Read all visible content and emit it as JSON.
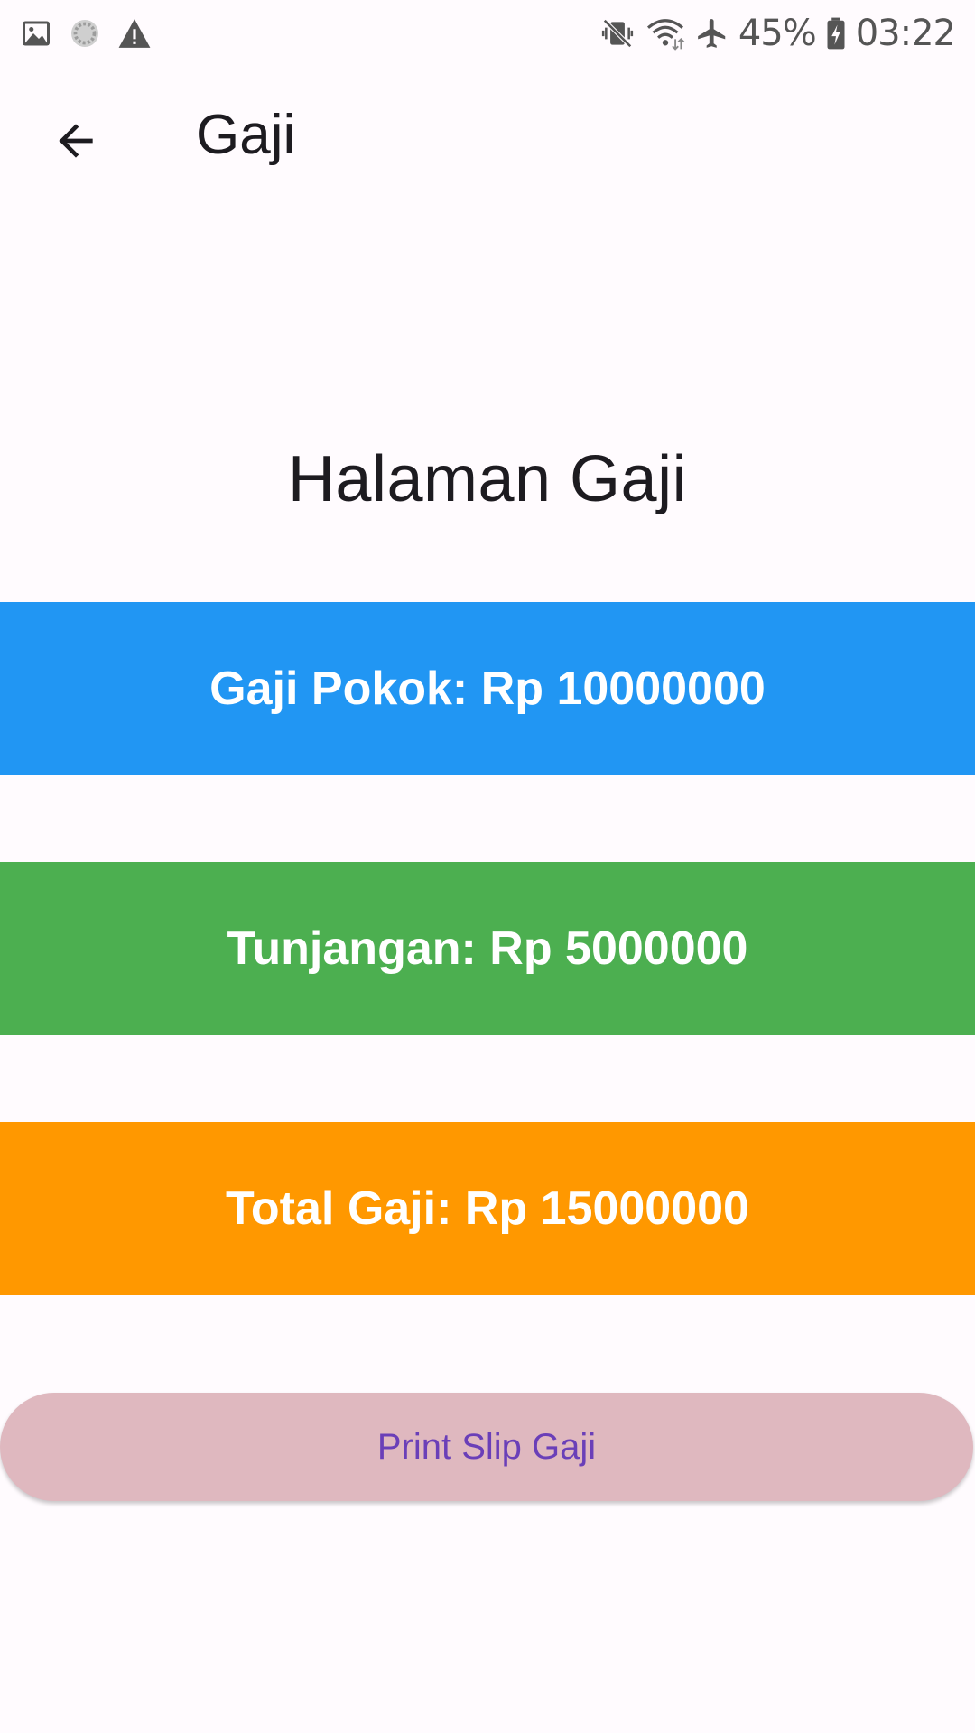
{
  "status_bar": {
    "battery": "45%",
    "time": "03:22",
    "left_icons": [
      "image-icon",
      "sync-circle-icon",
      "warning-icon"
    ],
    "right_icons": [
      "mute-vibrate-icon",
      "wifi-icon",
      "airplane-icon",
      "battery-charging-icon"
    ]
  },
  "app_bar": {
    "back_icon": "arrow-back-icon",
    "title": "Gaji"
  },
  "page": {
    "heading": "Halaman Gaji"
  },
  "cards": {
    "gaji_pokok": "Gaji Pokok: Rp 10000000",
    "tunjangan": "Tunjangan: Rp 5000000",
    "total": "Total Gaji: Rp 15000000"
  },
  "actions": {
    "print_label": "Print Slip Gaji"
  },
  "colors": {
    "background": "#fffbfe",
    "gaji_pokok_bg": "#2196f3",
    "tunjangan_bg": "#4caf50",
    "total_bg": "#ff9800",
    "print_button_bg": "#dfb8bf",
    "print_button_text": "#6a3fb8"
  }
}
